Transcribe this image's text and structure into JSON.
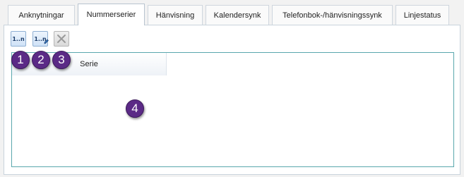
{
  "tabs": [
    {
      "label": "Anknytningar",
      "active": false
    },
    {
      "label": "Nummerserier",
      "active": true
    },
    {
      "label": "Hänvisning",
      "active": false
    },
    {
      "label": "Kalendersynk",
      "active": false
    },
    {
      "label": "Telefonbok-/hänvisningssynk",
      "active": false
    },
    {
      "label": "Linjestatus",
      "active": false
    }
  ],
  "toolbar": {
    "new_series_label": "1..n",
    "edit_series_label": "1..n",
    "delete_icon": "close-icon"
  },
  "grid": {
    "columns": [
      "Serie"
    ],
    "rows": []
  },
  "markers": [
    "1",
    "2",
    "3",
    "4"
  ],
  "colors": {
    "marker": "#5b2a86",
    "grid_border": "#5aa7ad",
    "button_border": "#8fb0d3"
  }
}
